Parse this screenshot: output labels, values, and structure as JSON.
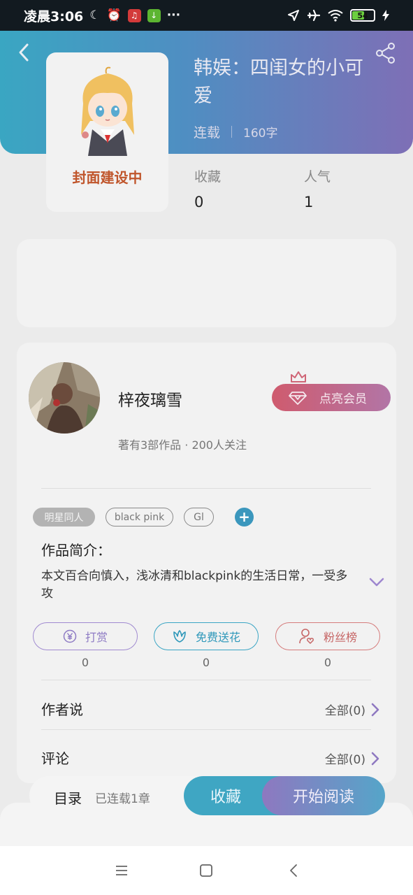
{
  "status_bar": {
    "time": "凌晨3:06",
    "battery_level": "54",
    "icons": [
      "moon-icon",
      "alarm-icon",
      "netease-app-icon",
      "download-app-icon",
      "more-dots-icon",
      "location-icon",
      "airplane-icon",
      "wifi-icon",
      "battery-icon",
      "charging-icon"
    ]
  },
  "header": {
    "back_icon": "chevron-left-icon",
    "share_icon": "share-icon"
  },
  "book": {
    "cover_text": "封面建设中",
    "title": "韩娱：四闺女的小可爱",
    "status": "连载",
    "word_count": "160字",
    "stats": [
      {
        "label": "收藏",
        "value": "0"
      },
      {
        "label": "人气",
        "value": "1"
      }
    ]
  },
  "author": {
    "name": "梓夜璃雪",
    "stats": "著有3部作品 · 200人关注",
    "vip_button": "点亮会员"
  },
  "tags": [
    "明星同人",
    "black pink",
    "Gl"
  ],
  "intro": {
    "title": "作品简介：",
    "text": "本文百合向慎入，浅冰清和blackpink的生活日常，一受多攻"
  },
  "actions": [
    {
      "label": "打赏",
      "icon": "yen-coin-icon",
      "count": "0"
    },
    {
      "label": "免费送花",
      "icon": "flower-icon",
      "count": "0"
    },
    {
      "label": "粉丝榜",
      "icon": "user-heart-icon",
      "count": "0"
    }
  ],
  "author_says": {
    "title": "作者说",
    "more": "全部(0)"
  },
  "comments": {
    "title": "评论",
    "more": "全部(0)"
  },
  "bottom_bar": {
    "toc": "目录",
    "toc_status": "已连载1章",
    "collect": "收藏",
    "read": "开始阅读"
  },
  "colors": {
    "header_gradient_start": "#3aa6c2",
    "header_gradient_end": "#7e6fb6",
    "accent_blue": "#3fa6c3",
    "accent_purple": "#8e78c0",
    "cover_text": "#c0562c",
    "vip_start": "#cf5b6e"
  }
}
